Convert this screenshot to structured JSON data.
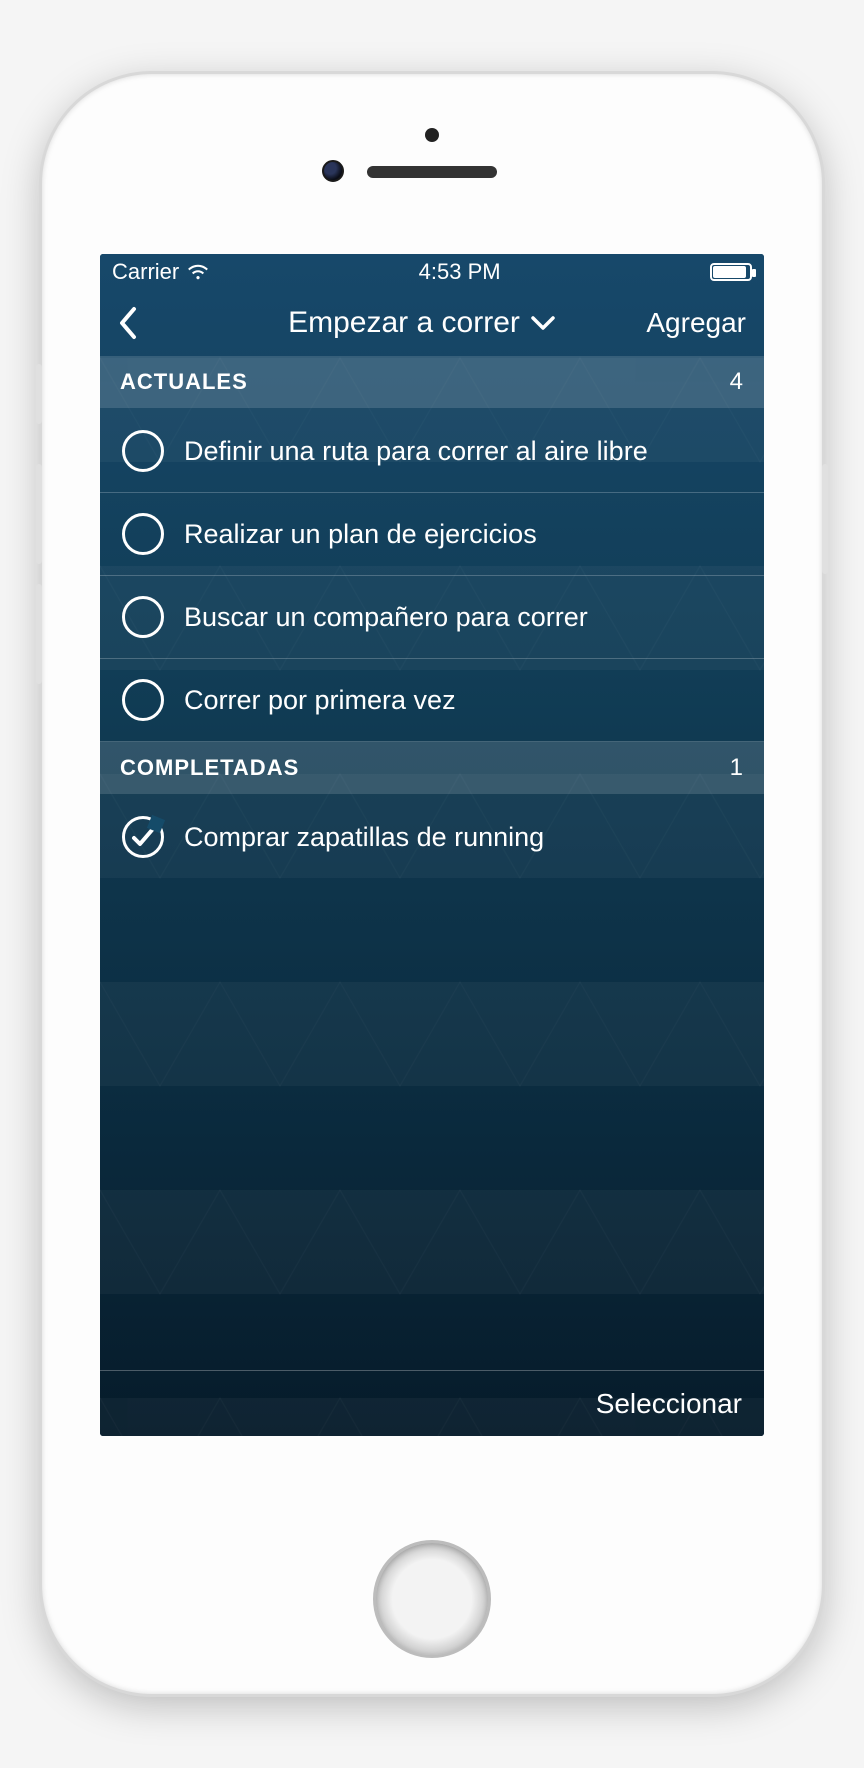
{
  "status_bar": {
    "carrier": "Carrier",
    "time": "4:53 PM"
  },
  "nav": {
    "title": "Empezar a correr",
    "add_label": "Agregar"
  },
  "sections": {
    "current": {
      "title": "ACTUALES",
      "count": "4",
      "items": [
        "Definir una ruta para correr al aire libre",
        "Realizar un plan de ejercicios",
        "Buscar un compañero para correr",
        "Correr por primera vez"
      ]
    },
    "completed": {
      "title": "COMPLETADAS",
      "count": "1",
      "items": [
        "Comprar zapatillas de running"
      ]
    }
  },
  "footer": {
    "select_label": "Seleccionar"
  }
}
